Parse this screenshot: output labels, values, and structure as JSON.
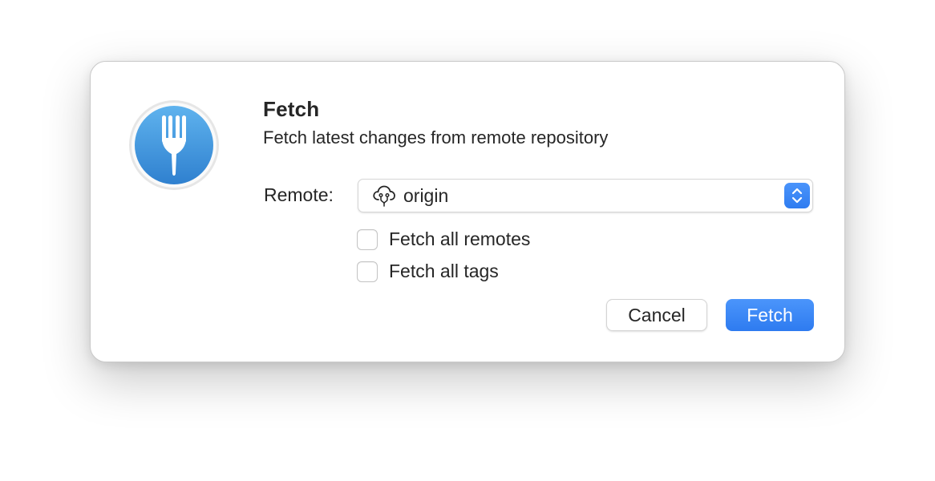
{
  "dialog": {
    "title": "Fetch",
    "subtitle": "Fetch latest changes from remote repository",
    "app_icon": "fork-icon"
  },
  "remote": {
    "label": "Remote:",
    "selected": "origin",
    "icon": "cloud-remote-icon"
  },
  "options": [
    {
      "label": "Fetch all remotes",
      "checked": false
    },
    {
      "label": "Fetch all tags",
      "checked": false
    }
  ],
  "buttons": {
    "cancel_label": "Cancel",
    "primary_label": "Fetch"
  },
  "colors": {
    "accent": "#2f7cf0",
    "icon_blue": "#3a8fdc"
  }
}
